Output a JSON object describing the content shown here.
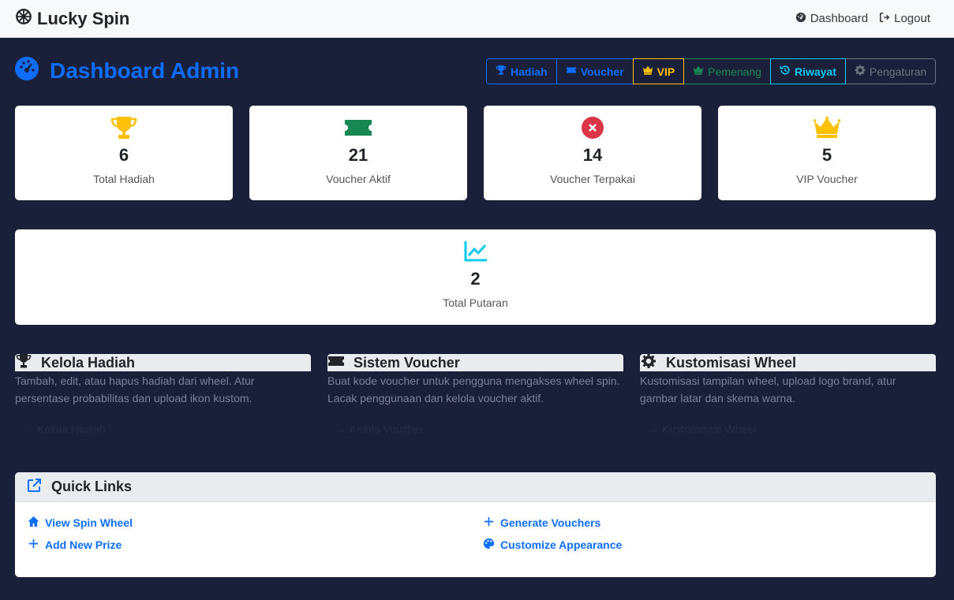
{
  "navbar": {
    "brand": "Lucky Spin",
    "dashboard": "Dashboard",
    "logout": "Logout"
  },
  "header": {
    "title": "Dashboard Admin",
    "buttons": [
      {
        "label": "Hadiah",
        "icon": "trophy-icon",
        "color": "#0d6efd"
      },
      {
        "label": "Voucher",
        "icon": "ticket-icon",
        "color": "#0d6efd"
      },
      {
        "label": "VIP",
        "icon": "crown-icon",
        "color": "#ffc107"
      },
      {
        "label": "Pemenang",
        "icon": "crown-icon",
        "color": "#198754"
      },
      {
        "label": "Riwayat",
        "icon": "history-icon",
        "color": "#0dcaf0"
      },
      {
        "label": "Pengaturan",
        "icon": "gear-icon",
        "color": "#6c757d"
      }
    ]
  },
  "stats": [
    {
      "value": "6",
      "label": "Total Hadiah",
      "icon": "trophy-icon",
      "color": "#ffc107"
    },
    {
      "value": "21",
      "label": "Voucher Aktif",
      "icon": "ticket-icon",
      "color": "#198754"
    },
    {
      "value": "14",
      "label": "Voucher Terpakai",
      "icon": "x-circle-icon",
      "color": "#dc3545"
    },
    {
      "value": "5",
      "label": "VIP Voucher",
      "icon": "crown-icon",
      "color": "#ffc107"
    }
  ],
  "total_spins": {
    "value": "2",
    "label": "Total Putaran",
    "icon": "chart-line-icon",
    "color": "#0dcaf0"
  },
  "features": [
    {
      "title": "Kelola Hadiah",
      "desc": "Tambah, edit, atau hapus hadiah dari wheel. Atur persentase probabilitas dan upload ikon kustom.",
      "link": "→ Kelola Hadiah"
    },
    {
      "title": "Sistem Voucher",
      "desc": "Buat kode voucher untuk pengguna mengakses wheel spin. Lacak penggunaan dan kelola voucher aktif.",
      "link": "→ Kelola Voucher"
    },
    {
      "title": "Kustomisasi Wheel",
      "desc": "Kustomisasi tampilan wheel, upload logo brand, atur gambar latar dan skema warna.",
      "link": "→ Kustomisasi Wheel"
    }
  ],
  "quick_links": {
    "title": "Quick Links",
    "items": [
      {
        "label": "View Spin Wheel",
        "icon": "home-icon"
      },
      {
        "label": "Add New Prize",
        "icon": "plus-icon"
      },
      {
        "label": "Generate Vouchers",
        "icon": "plus-icon"
      },
      {
        "label": "Customize Appearance",
        "icon": "palette-icon"
      }
    ]
  }
}
